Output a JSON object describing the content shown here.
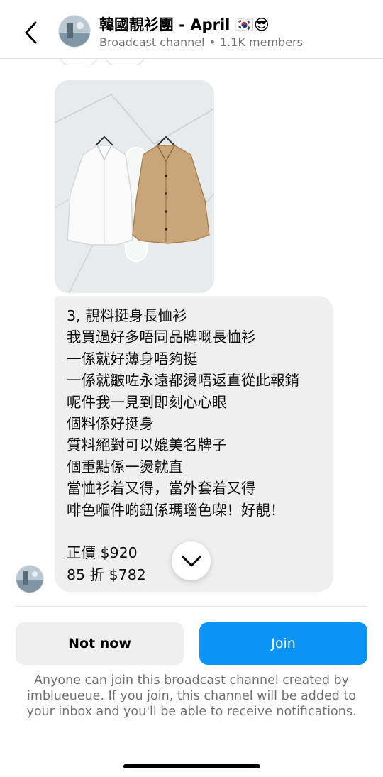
{
  "header": {
    "title": "韓國靚衫團 - April 🇰🇷😎",
    "channel_type": "Broadcast channel",
    "separator": "•",
    "members": "1.1K members"
  },
  "message": {
    "lines": "3, 靚料挺身長恤衫\n我買過好多唔同品牌嘅長恤衫\n一係就好薄身唔夠挺\n一係就皺咗永遠都燙唔返直從此報銷\n呢件我一見到即刻心心眼\n個料係好挺身\n質料絕對可以媲美名牌子\n個重點係一燙就直\n當恤衫着又得，當外套着又得\n啡色嗰件啲鈕係瑪瑙色㗎！好靚！\n\n正價 $920\n85 折 $782"
  },
  "actions": {
    "not_now_label": "Not now",
    "join_label": "Join"
  },
  "footer": {
    "disclaimer": "Anyone can join this broadcast channel created by imblueueue. If you join, this channel will be added to your inbox and you'll be able to receive notifications."
  },
  "colors": {
    "join_button": "#0a95f6",
    "bubble": "#efefef",
    "secondary_text": "#737373"
  },
  "icons": {
    "back": "chevron-left-icon",
    "scroll_down": "chevron-down-icon"
  }
}
